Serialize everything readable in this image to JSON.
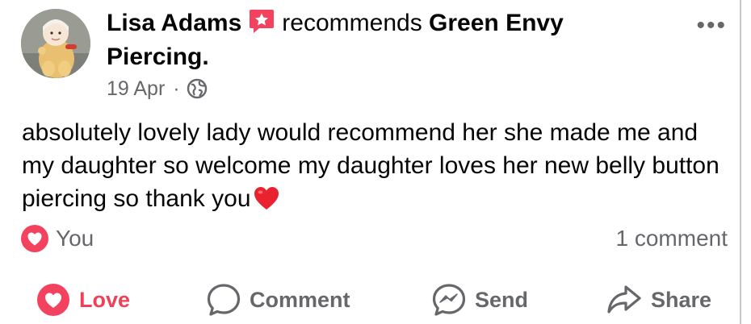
{
  "post": {
    "author": "Lisa Adams",
    "action_text": "recommends",
    "page_name_line1": "Green Envy",
    "page_name_line2": "Piercing.",
    "date": "19 Apr",
    "dot": "·",
    "audience_icon": "globe-icon",
    "more_label": "•••",
    "text": "absolutely lovely lady would recommend her she made me and my daughter so welcome my daughter loves her new belly button piercing so thank you",
    "text_emoji": "heart-emoji"
  },
  "reactions": {
    "reactor": "You",
    "icon": "love-reaction-icon",
    "comment_count": "1 comment"
  },
  "actions": {
    "love": "Love",
    "comment": "Comment",
    "send": "Send",
    "share": "Share"
  },
  "colors": {
    "love": "#f33e58",
    "secondary_text": "#65676b",
    "badge": "#f3425f"
  }
}
